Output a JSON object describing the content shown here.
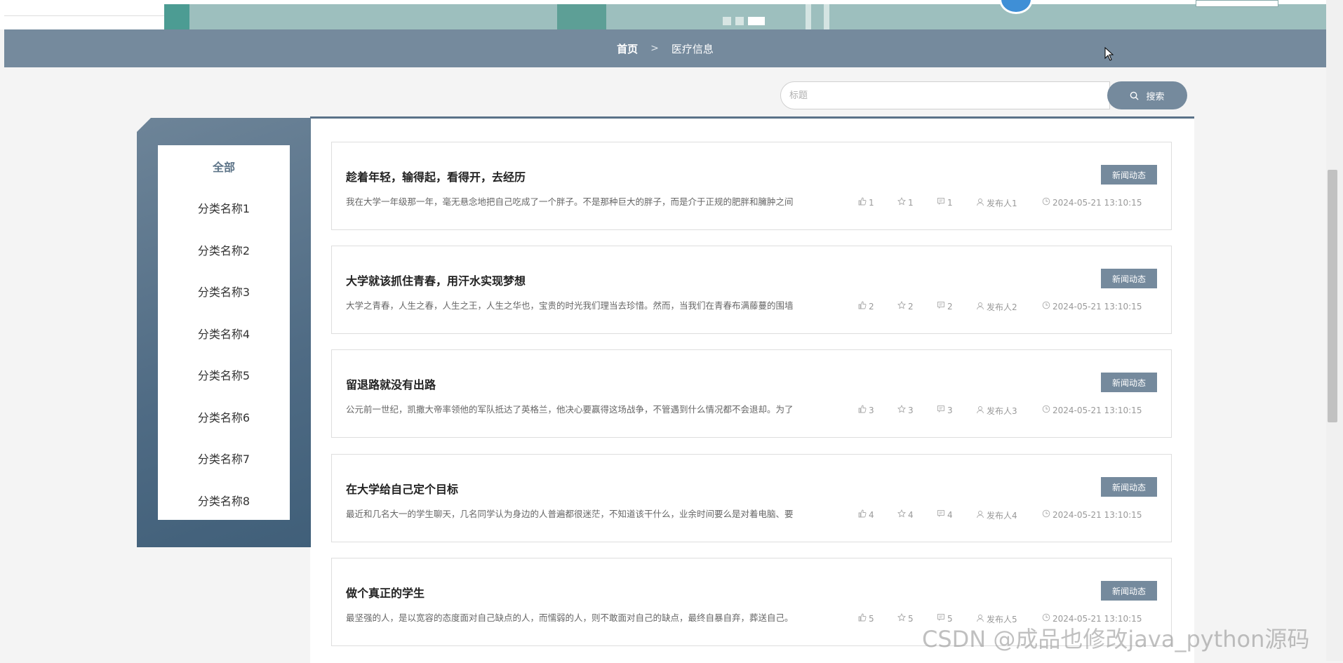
{
  "banner": {
    "slides": 3,
    "active_slide": 3
  },
  "breadcrumb": {
    "home": "首页",
    "separator": ">",
    "current": "医疗信息"
  },
  "search": {
    "placeholder": "标题",
    "value": "",
    "button_label": "搜索"
  },
  "sidebar": {
    "items": [
      {
        "label": "全部",
        "active": true
      },
      {
        "label": "分类名称1"
      },
      {
        "label": "分类名称2"
      },
      {
        "label": "分类名称3"
      },
      {
        "label": "分类名称4"
      },
      {
        "label": "分类名称5"
      },
      {
        "label": "分类名称6"
      },
      {
        "label": "分类名称7"
      },
      {
        "label": "分类名称8"
      }
    ]
  },
  "articles": [
    {
      "title": "趁着年轻，输得起，看得开，去经历",
      "excerpt": "我在大学一年级那一年，毫无悬念地把自己吃成了一个胖子。不是那种巨大的胖子，而是介于正规的肥胖和臃肿之间",
      "tag": "新闻动态",
      "likes": "1",
      "favorites": "1",
      "comments": "1",
      "author": "发布人1",
      "time": "2024-05-21 13:10:15"
    },
    {
      "title": "大学就该抓住青春，用汗水实现梦想",
      "excerpt": "大学之青春，人生之春，人生之王，人生之华也，宝贵的时光我们理当去珍惜。然而，当我们在青春布满藤蔓的围墙",
      "tag": "新闻动态",
      "likes": "2",
      "favorites": "2",
      "comments": "2",
      "author": "发布人2",
      "time": "2024-05-21 13:10:15"
    },
    {
      "title": "留退路就没有出路",
      "excerpt": "公元前一世纪，凯撒大帝率领他的军队抵达了英格兰，他决心要赢得这场战争，不管遇到什么情况都不会退却。为了",
      "tag": "新闻动态",
      "likes": "3",
      "favorites": "3",
      "comments": "3",
      "author": "发布人3",
      "time": "2024-05-21 13:10:15"
    },
    {
      "title": "在大学给自己定个目标",
      "excerpt": "最近和几名大一的学生聊天，几名同学认为身边的人普遍都很迷茫，不知道该干什么，业余时间要么是对着电脑、要",
      "tag": "新闻动态",
      "likes": "4",
      "favorites": "4",
      "comments": "4",
      "author": "发布人4",
      "time": "2024-05-21 13:10:15"
    },
    {
      "title": "做个真正的学生",
      "excerpt": "最坚强的人，是以宽容的态度面对自己缺点的人，而懦弱的人，则不敢面对自己的缺点，最终自暴自弃，葬送自己。",
      "tag": "新闻动态",
      "likes": "5",
      "favorites": "5",
      "comments": "5",
      "author": "发布人5",
      "time": "2024-05-21 13:10:15"
    }
  ],
  "watermark": "CSDN @成品也修改java_python源码",
  "colors": {
    "accent": "#758a9d",
    "sidebar_gradient_dark": "#405f79",
    "card_border": "#dedede"
  },
  "icons": {
    "like": "thumbs-up-icon",
    "favorite": "star-icon",
    "comment": "comment-icon",
    "author": "user-icon",
    "time": "clock-icon",
    "search": "search-icon"
  }
}
